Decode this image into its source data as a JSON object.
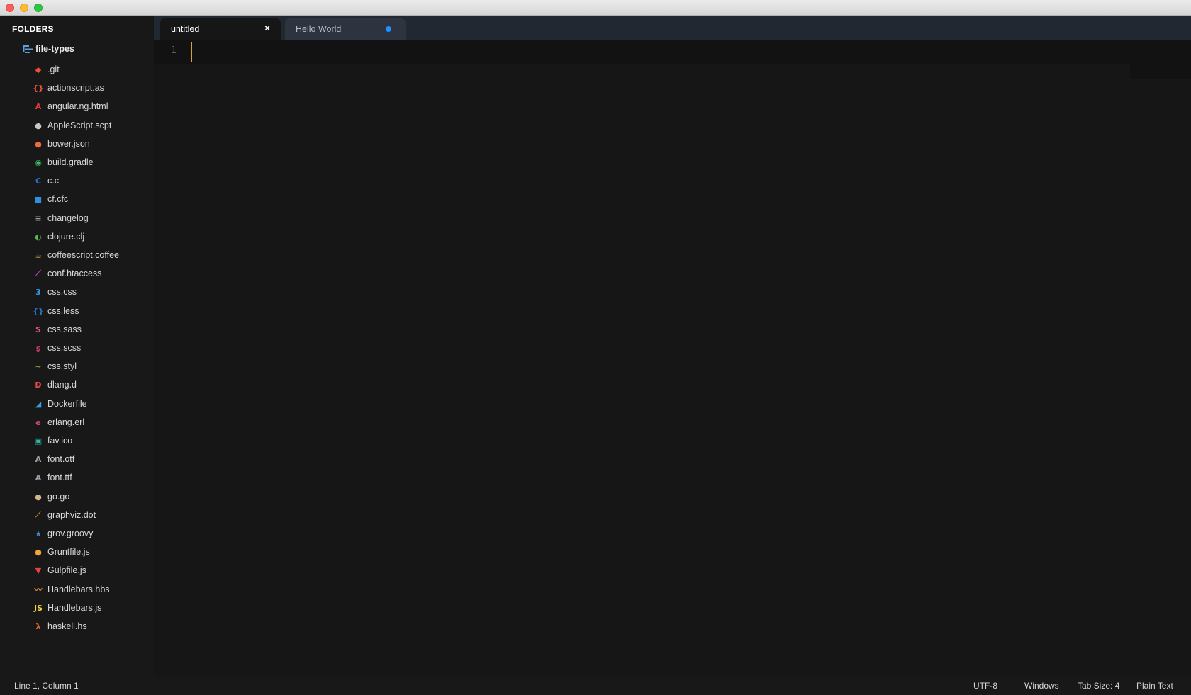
{
  "window": {
    "buttons": [
      "close",
      "minimize",
      "maximize"
    ]
  },
  "sidebar": {
    "header": "FOLDERS",
    "folder": {
      "name": "file-types",
      "icon": "folder-tree-icon"
    },
    "files": [
      {
        "name": ".git",
        "icon": "git-icon",
        "color": "#e8503a"
      },
      {
        "name": "actionscript.as",
        "icon": "actionscript-icon",
        "color": "#e8503a"
      },
      {
        "name": "angular.ng.html",
        "icon": "angular-icon",
        "color": "#dd3a3a"
      },
      {
        "name": "AppleScript.scpt",
        "icon": "apple-icon",
        "color": "#c8c8c8"
      },
      {
        "name": "bower.json",
        "icon": "bower-icon",
        "color": "#ef6a3e"
      },
      {
        "name": "build.gradle",
        "icon": "gradle-icon",
        "color": "#37c26a"
      },
      {
        "name": "c.c",
        "icon": "c-icon",
        "color": "#2d6fc7"
      },
      {
        "name": "cf.cfc",
        "icon": "coldfusion-icon",
        "color": "#2f8ee0"
      },
      {
        "name": "changelog",
        "icon": "changelog-icon",
        "color": "#9aa3ad"
      },
      {
        "name": "clojure.clj",
        "icon": "clojure-icon",
        "color": "#5ab552"
      },
      {
        "name": "coffeescript.coffee",
        "icon": "coffee-icon",
        "color": "#e6a23b"
      },
      {
        "name": "conf.htaccess",
        "icon": "apache-feather-icon",
        "color": "#c13ac6"
      },
      {
        "name": "css.css",
        "icon": "css3-icon",
        "color": "#2d9cf0"
      },
      {
        "name": "css.less",
        "icon": "less-icon",
        "color": "#2d6fc7"
      },
      {
        "name": "css.sass",
        "icon": "sass-icon",
        "color": "#d5578f"
      },
      {
        "name": "css.scss",
        "icon": "scss-icon",
        "color": "#c23a6e"
      },
      {
        "name": "css.styl",
        "icon": "stylus-icon",
        "color": "#8a9a2e"
      },
      {
        "name": "dlang.d",
        "icon": "dlang-icon",
        "color": "#e44b4b"
      },
      {
        "name": "Dockerfile",
        "icon": "docker-icon",
        "color": "#2fa3dc"
      },
      {
        "name": "erlang.erl",
        "icon": "erlang-icon",
        "color": "#d8457a"
      },
      {
        "name": "fav.ico",
        "icon": "image-icon",
        "color": "#31b4a8"
      },
      {
        "name": "font.otf",
        "icon": "font-icon",
        "color": "#9aa3ad"
      },
      {
        "name": "font.ttf",
        "icon": "font-icon",
        "color": "#9aa3ad"
      },
      {
        "name": "go.go",
        "icon": "gopher-icon",
        "color": "#d4b48c"
      },
      {
        "name": "graphviz.dot",
        "icon": "graphviz-icon",
        "color": "#d88a30"
      },
      {
        "name": "grov.groovy",
        "icon": "groovy-star-icon",
        "color": "#3f8bd6"
      },
      {
        "name": "Gruntfile.js",
        "icon": "grunt-icon",
        "color": "#f0a43a"
      },
      {
        "name": "Gulpfile.js",
        "icon": "gulp-icon",
        "color": "#e0463e"
      },
      {
        "name": "Handlebars.hbs",
        "icon": "handlebars-icon",
        "color": "#e8923a"
      },
      {
        "name": "Handlebars.js",
        "icon": "javascript-icon",
        "color": "#f0d33a"
      },
      {
        "name": "haskell.hs",
        "icon": "haskell-icon",
        "color": "#e8602e"
      }
    ]
  },
  "tabs": [
    {
      "label": "untitled",
      "active": true,
      "close_glyph": "×"
    },
    {
      "label": "Hello World",
      "active": false,
      "dirty": true
    }
  ],
  "editor": {
    "line_number": "1"
  },
  "status": {
    "position": "Line 1, Column 1",
    "encoding": "UTF-8",
    "line_endings": "Windows",
    "tab_size": "Tab Size: 4",
    "syntax": "Plain Text"
  }
}
